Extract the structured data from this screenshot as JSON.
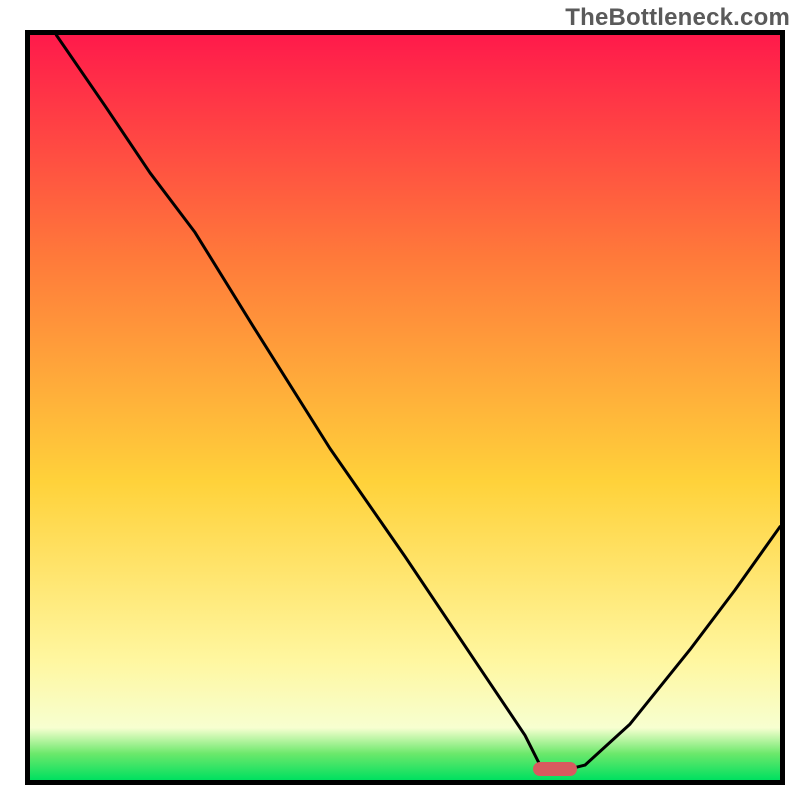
{
  "watermark": "TheBottleneck.com",
  "gradient_colors": {
    "top": "#ff1a4b",
    "upper_mid": "#ff7a3a",
    "mid": "#ffd23a",
    "lower_mid": "#fff7a0",
    "pale_band": "#f7ffd0",
    "green_top": "#6be86b",
    "green_base": "#00e060"
  },
  "marker": {
    "color": "#d75a5f",
    "x_frac": 0.7,
    "y_frac": 0.985
  },
  "chart_data": {
    "type": "line",
    "title": "",
    "xlabel": "",
    "ylabel": "",
    "xlim": [
      0,
      1
    ],
    "ylim": [
      0,
      1
    ],
    "note": "Axes have no tick labels in the source image; x and y are recorded as fractions of the plot area (0 = left/bottom, 1 = right/top). The curve descends from top-left, has a soft knee near x≈0.22, reaches a flat minimum around x≈0.68–0.74 at y≈0.015, then rises toward the right edge.",
    "series": [
      {
        "name": "curve",
        "x": [
          0.035,
          0.1,
          0.16,
          0.22,
          0.3,
          0.4,
          0.5,
          0.6,
          0.66,
          0.68,
          0.72,
          0.74,
          0.8,
          0.88,
          0.94,
          1.0
        ],
        "y": [
          1.0,
          0.905,
          0.815,
          0.735,
          0.605,
          0.445,
          0.3,
          0.15,
          0.06,
          0.02,
          0.015,
          0.02,
          0.075,
          0.175,
          0.255,
          0.34
        ]
      }
    ],
    "marker": {
      "shape": "rounded-bar",
      "x_center_frac": 0.71,
      "y_center_frac": 0.012,
      "color": "#d75a5f"
    },
    "background_gradient": {
      "direction": "top-to-bottom",
      "stops": [
        {
          "pos": 0.0,
          "color": "#ff1a4b"
        },
        {
          "pos": 0.3,
          "color": "#ff7a3a"
        },
        {
          "pos": 0.6,
          "color": "#ffd23a"
        },
        {
          "pos": 0.84,
          "color": "#fff7a0"
        },
        {
          "pos": 0.93,
          "color": "#f7ffd0"
        },
        {
          "pos": 0.965,
          "color": "#6be86b"
        },
        {
          "pos": 1.0,
          "color": "#00e060"
        }
      ]
    }
  }
}
